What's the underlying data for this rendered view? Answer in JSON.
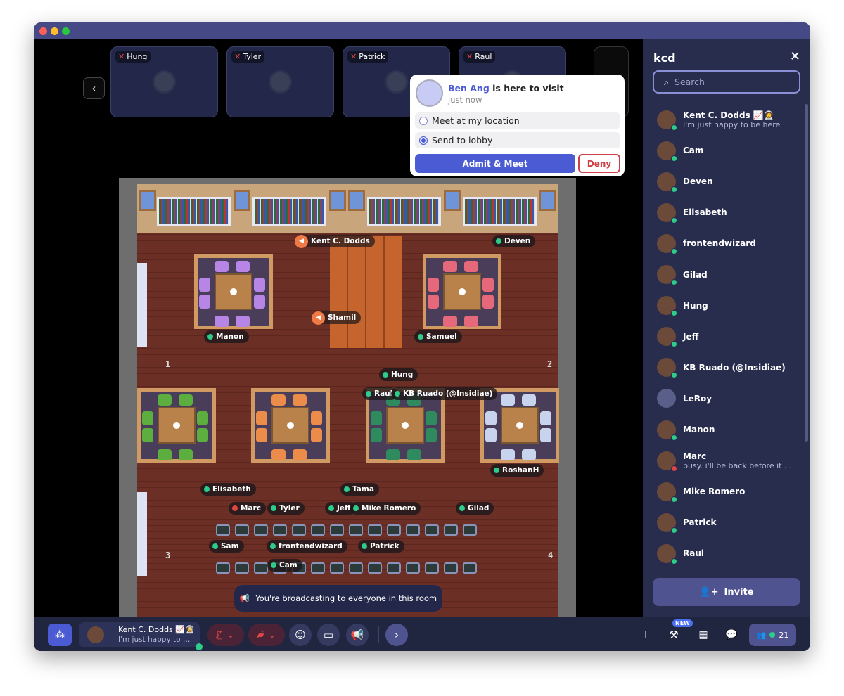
{
  "window": {
    "title_bar_colors": {
      "close": "#ff5f57",
      "minimize": "#febc2e",
      "zoom": "#28c840"
    }
  },
  "video_tiles": [
    {
      "name": "Hung",
      "mic": "muted"
    },
    {
      "name": "Tyler",
      "mic": "muted"
    },
    {
      "name": "Patrick",
      "mic": "muted"
    },
    {
      "name": "Raul",
      "mic": "muted"
    }
  ],
  "popup": {
    "visitor": "Ben Ang",
    "message": " is here to visit",
    "time": "just now",
    "options": [
      {
        "label": "Meet at my location",
        "selected": false
      },
      {
        "label": "Send to lobby",
        "selected": true
      }
    ],
    "admit_label": "Admit & Meet",
    "deny_label": "Deny"
  },
  "map": {
    "labels": [
      {
        "name": "Kent C. Dodds",
        "status": "broadcasting"
      },
      {
        "name": "Deven",
        "status": "online"
      },
      {
        "name": "Shamil",
        "status": "broadcasting"
      },
      {
        "name": "Manon",
        "status": "online"
      },
      {
        "name": "Samuel",
        "status": "online"
      },
      {
        "name": "Hung",
        "status": "online"
      },
      {
        "name": "Raul",
        "status": "online"
      },
      {
        "name": "KB Ruado (@Insidiae)",
        "status": "online"
      },
      {
        "name": "RoshanH",
        "status": "online"
      },
      {
        "name": "Elisabeth",
        "status": "online"
      },
      {
        "name": "Tama",
        "status": "online"
      },
      {
        "name": "Marc",
        "status": "busy"
      },
      {
        "name": "Tyler",
        "status": "online"
      },
      {
        "name": "Jeff",
        "status": "online"
      },
      {
        "name": "Mike Romero",
        "status": "online"
      },
      {
        "name": "Gilad",
        "status": "online"
      },
      {
        "name": "Sam",
        "status": "online"
      },
      {
        "name": "frontendwizard",
        "status": "online"
      },
      {
        "name": "Patrick",
        "status": "online"
      },
      {
        "name": "Cam",
        "status": "online"
      }
    ],
    "area_numbers": [
      "1",
      "2",
      "3",
      "4"
    ],
    "broadcast_banner": "You're broadcasting to everyone in this room"
  },
  "sidebar": {
    "title": "kcd",
    "search_placeholder": "Search",
    "members": [
      {
        "name": "Kent C. Dodds 📈👩‍🚀",
        "status_text": "I'm just happy to be here",
        "status": "online"
      },
      {
        "name": "Cam",
        "status": "online"
      },
      {
        "name": "Deven",
        "status": "online"
      },
      {
        "name": "Elisabeth",
        "status": "online"
      },
      {
        "name": "frontendwizard",
        "status": "online"
      },
      {
        "name": "Gilad",
        "status": "online"
      },
      {
        "name": "Hung",
        "status": "online"
      },
      {
        "name": "Jeff",
        "status": "online"
      },
      {
        "name": "KB Ruado (@Insidiae)",
        "status": "online"
      },
      {
        "name": "LeRoy",
        "status": "offline"
      },
      {
        "name": "Manon",
        "status": "online"
      },
      {
        "name": "Marc",
        "status_text": "busy. i'll be back before it starts",
        "status": "busy"
      },
      {
        "name": "Mike Romero",
        "status": "online"
      },
      {
        "name": "Patrick",
        "status": "online"
      },
      {
        "name": "Raul",
        "status": "online"
      }
    ],
    "invite_label": "Invite"
  },
  "bottom_bar": {
    "me_name": "Kent C. Dodds 📈👩‍🚀",
    "me_status": "I'm just happy to be here",
    "new_badge": "NEW",
    "participant_count": "21"
  },
  "colors": {
    "accent": "#4a5bd4",
    "online": "#2ecc8a",
    "busy": "#e04444",
    "broadcast": "#f07a45",
    "sidebar": "#282d4e"
  }
}
